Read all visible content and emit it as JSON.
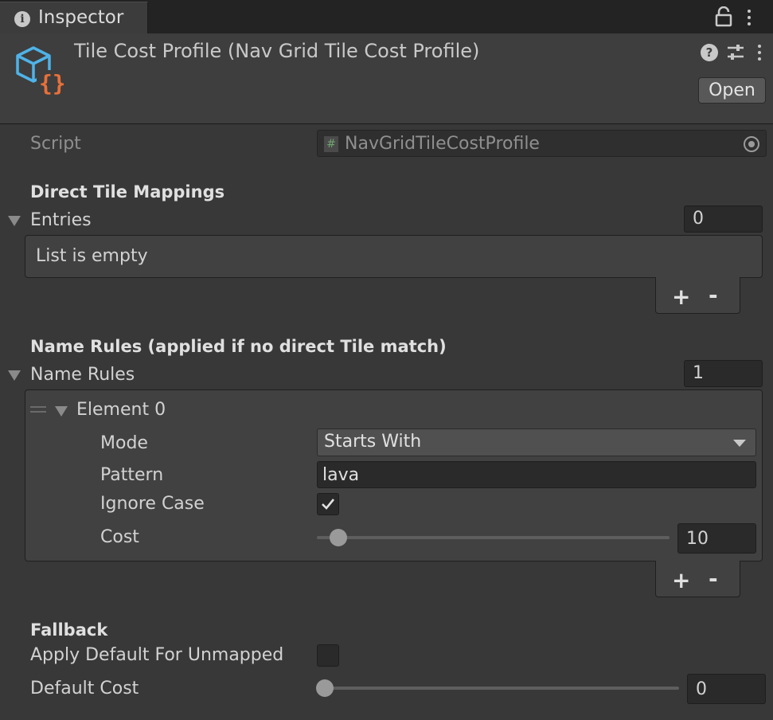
{
  "tab": {
    "label": "Inspector"
  },
  "header": {
    "title": "Tile Cost Profile (Nav Grid Tile Cost Profile)",
    "open_label": "Open"
  },
  "script": {
    "label": "Script",
    "value": "NavGridTileCostProfile"
  },
  "direct_tile_mappings": {
    "heading": "Direct Tile Mappings",
    "entries_label": "Entries",
    "entries_count": "0",
    "empty_text": "List is empty"
  },
  "name_rules": {
    "heading": "Name Rules (applied if no direct Tile match)",
    "label": "Name Rules",
    "count": "1",
    "element": {
      "label": "Element 0",
      "mode_label": "Mode",
      "mode_value": "Starts With",
      "pattern_label": "Pattern",
      "pattern_value": "lava",
      "ignore_case_label": "Ignore Case",
      "ignore_case": true,
      "cost_label": "Cost",
      "cost_value": "10"
    }
  },
  "list_controls": {
    "plus": "+",
    "minus": "-"
  },
  "fallback": {
    "heading": "Fallback",
    "apply_default_label": "Apply Default For Unmapped",
    "apply_default": false,
    "default_cost_label": "Default Cost",
    "default_cost_value": "0"
  },
  "colors": {
    "background": "#383838",
    "accent_orange": "#e8703a",
    "accent_blue": "#4fb3e8"
  }
}
